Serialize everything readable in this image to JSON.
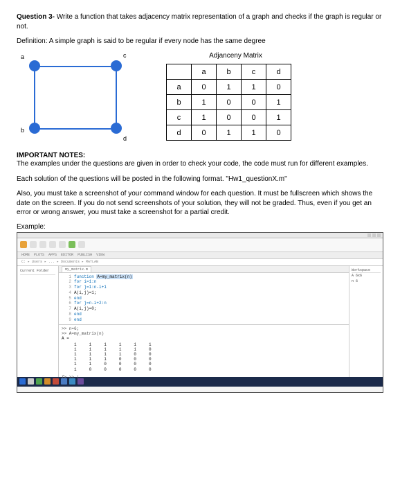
{
  "question": {
    "label": "Question 3-",
    "text": " Write a function that takes adjacency matrix representation of a graph and checks if the graph is regular or not."
  },
  "definition": "Definition: A simple graph is said to be regular if every node has the same degree",
  "matrix_title": "Adjanceny Matrix",
  "graph_labels": {
    "a": "a",
    "b": "b",
    "c": "c",
    "d": "d"
  },
  "adjacency": {
    "headers": [
      "a",
      "b",
      "c",
      "d"
    ],
    "rows": [
      {
        "label": "a",
        "cells": [
          "0",
          "1",
          "1",
          "0"
        ]
      },
      {
        "label": "b",
        "cells": [
          "1",
          "0",
          "0",
          "1"
        ]
      },
      {
        "label": "c",
        "cells": [
          "1",
          "0",
          "0",
          "1"
        ]
      },
      {
        "label": "d",
        "cells": [
          "0",
          "1",
          "1",
          "0"
        ]
      }
    ]
  },
  "notes": {
    "head": "IMPORTANT NOTES:",
    "p1": "The examples under the questions are given in order to check your code, the code must run for different examples.",
    "p2": "Each solution of the questions will be posted in the following format. \"Hw1_questionX.m\"",
    "p3": "Also, you must take a screenshot of your command window for each question. It must be fullscreen which shows the date on the screen. If you do not send screenshots of your solution, they will not be graded. Thus, even if you get an error or wrong answer, you must take a screenshot for a partial credit."
  },
  "example_label": "Example:",
  "screenshot": {
    "ribbon": [
      "HOME",
      "PLOTS",
      "APPS",
      "EDITOR",
      "PUBLISH",
      "VIEW"
    ],
    "path": "C: ▸ Users ▸ ... ▸ Documents ▸ MATLAB",
    "left_panels": [
      "Current Folder",
      ""
    ],
    "editor_tab": "my_matrix.m",
    "code_fn_kw": "function",
    "code_fn_sig": "A=my_matrix(n)",
    "code_lines": [
      "for i=1:n",
      "    for j=1:n-i+1",
      "        A(i,j)=1;",
      "    end",
      "    for j=n-i+2:n",
      "        A(i,j)=0;",
      "    end",
      "end"
    ],
    "gutter": [
      "1",
      "2",
      "3",
      "4",
      "5",
      "6",
      "7",
      "8",
      "9"
    ],
    "cmd_lines": [
      ">> n=6;",
      ">> A=my_matrix(n)"
    ],
    "cmd_var": "A =",
    "cmd_matrix": "     1     1     1     1     1     1\n     1     1     1     1     1     0\n     1     1     1     1     0     0\n     1     1     1     0     0     0\n     1     1     0     0     0     0\n     1     0     0     0     0     0",
    "fx": "fx >> |",
    "workspace_title": "Workspace",
    "workspace": [
      {
        "name": "A",
        "val": "6x6"
      },
      {
        "name": "n",
        "val": "6"
      }
    ]
  },
  "taskbar_colors": [
    "#2a6bd4",
    "#4ea24e",
    "#d28b2a",
    "#c24a3a",
    "#4a7bc2",
    "#3a8ac2",
    "#6a4a9a",
    "#c24a8a"
  ]
}
